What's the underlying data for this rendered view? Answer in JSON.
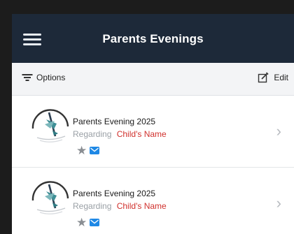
{
  "header": {
    "title": "Parents Evenings"
  },
  "toolbar": {
    "options_label": "Options",
    "edit_label": "Edit"
  },
  "events": [
    {
      "title": "Parents Evening 2025",
      "regarding_label": "Regarding",
      "child_name": "Child's Name"
    },
    {
      "title": "Parents Evening 2025",
      "regarding_label": "Regarding",
      "child_name": "Child's Name"
    }
  ],
  "colors": {
    "header_bg": "#1d2939",
    "child_name": "#d0312d",
    "mail_badge": "#1e88e5",
    "star": "#8a8e93"
  },
  "icons": {
    "menu": "hamburger-icon",
    "options": "filter-icon",
    "edit": "edit-icon",
    "row_logo": "school-logo-icon",
    "favorite": "star-icon",
    "message": "mail-icon",
    "disclosure": "chevron-right-icon"
  }
}
